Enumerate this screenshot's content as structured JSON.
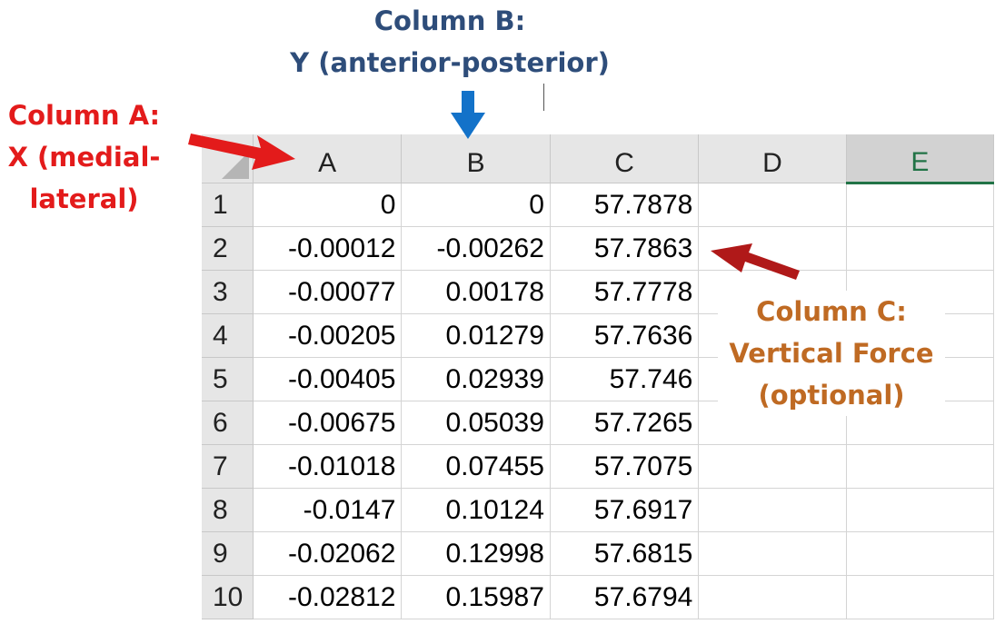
{
  "annotations": {
    "col_a": {
      "line1": "Column A:",
      "line2": "X (medial-",
      "line3": "lateral)",
      "color": "#e31b1b"
    },
    "col_b": {
      "line1": "Column B:",
      "line2": "Y (anterior-posterior)",
      "color": "#2e4d7a"
    },
    "col_c": {
      "line1": "Column C:",
      "line2": "Vertical Force",
      "line3": "(optional)",
      "color": "#bf6a23"
    }
  },
  "sheet": {
    "columns": [
      "A",
      "B",
      "C",
      "D",
      "E"
    ],
    "selected_column": "E",
    "rows": [
      {
        "num": "1",
        "a": "0",
        "b": "0",
        "c": "57.7878"
      },
      {
        "num": "2",
        "a": "-0.00012",
        "b": "-0.00262",
        "c": "57.7863"
      },
      {
        "num": "3",
        "a": "-0.00077",
        "b": "0.00178",
        "c": "57.7778"
      },
      {
        "num": "4",
        "a": "-0.00205",
        "b": "0.01279",
        "c": "57.7636"
      },
      {
        "num": "5",
        "a": "-0.00405",
        "b": "0.02939",
        "c": "57.746"
      },
      {
        "num": "6",
        "a": "-0.00675",
        "b": "0.05039",
        "c": "57.7265"
      },
      {
        "num": "7",
        "a": "-0.01018",
        "b": "0.07455",
        "c": "57.7075"
      },
      {
        "num": "8",
        "a": "-0.0147",
        "b": "0.10124",
        "c": "57.6917"
      },
      {
        "num": "9",
        "a": "-0.02062",
        "b": "0.12998",
        "c": "57.6815"
      },
      {
        "num": "10",
        "a": "-0.02812",
        "b": "0.15987",
        "c": "57.6794"
      }
    ]
  },
  "colors": {
    "header_bg": "#e6e6e6",
    "selected_header_accent": "#217346",
    "arrow_a": "#e31b1b",
    "arrow_b": "#1372c9",
    "arrow_c": "#b01919"
  }
}
